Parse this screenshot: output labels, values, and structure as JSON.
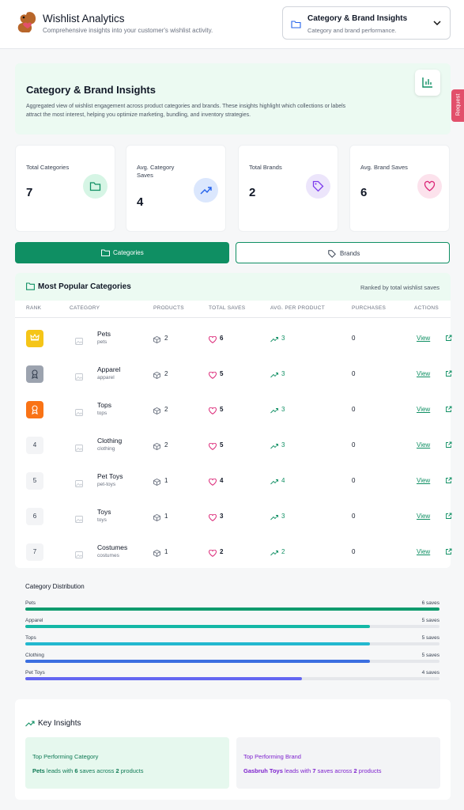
{
  "header": {
    "title": "Wishlist Analytics",
    "subtitle": "Comprehensive insights into your customer's wishlist activity."
  },
  "selector": {
    "title": "Category & Brand Insights",
    "subtitle": "Category and brand performance."
  },
  "request_tab": "Request",
  "hero": {
    "title": "Category & Brand Insights",
    "description": "Aggregated view of wishlist engagement across product categories and brands. These insights highlight which collections or labels attract the most interest, helping you optimize marketing, bundling, and inventory strategies."
  },
  "stats": [
    {
      "label": "Total Categories",
      "value": "7",
      "icon": "folder-icon",
      "color": "#0f8f63"
    },
    {
      "label": "Avg. Category Saves",
      "value": "4",
      "icon": "trending-up-icon",
      "color": "#2563eb"
    },
    {
      "label": "Total Brands",
      "value": "2",
      "icon": "tag-icon",
      "color": "#7c3aed"
    },
    {
      "label": "Avg. Brand Saves",
      "value": "6",
      "icon": "heart-icon",
      "color": "#db2777"
    }
  ],
  "tabs": {
    "categories": "Categories",
    "brands": "Brands"
  },
  "table": {
    "title": "Most Popular Categories",
    "ranked_note": "Ranked by total wishlist saves",
    "columns": [
      "RANK",
      "CATEGORY",
      "PRODUCTS",
      "TOTAL SAVES",
      "AVG. PER PRODUCT",
      "PURCHASES",
      "ACTIONS"
    ],
    "view_label": "View",
    "rows": [
      {
        "rank": "1",
        "rank_icon": "crown-icon",
        "name": "Pets",
        "slug": "pets",
        "products": "2",
        "saves": "6",
        "avg": "3",
        "purchases": "0"
      },
      {
        "rank": "2",
        "rank_icon": "medal-icon",
        "name": "Apparel",
        "slug": "apparel",
        "products": "2",
        "saves": "5",
        "avg": "3",
        "purchases": "0"
      },
      {
        "rank": "3",
        "rank_icon": "award-icon",
        "name": "Tops",
        "slug": "tops",
        "products": "2",
        "saves": "5",
        "avg": "3",
        "purchases": "0"
      },
      {
        "rank": "4",
        "name": "Clothing",
        "slug": "clothing",
        "products": "2",
        "saves": "5",
        "avg": "3",
        "purchases": "0"
      },
      {
        "rank": "5",
        "name": "Pet Toys",
        "slug": "pet-toys",
        "products": "1",
        "saves": "4",
        "avg": "4",
        "purchases": "0"
      },
      {
        "rank": "6",
        "name": "Toys",
        "slug": "toys",
        "products": "1",
        "saves": "3",
        "avg": "3",
        "purchases": "0"
      },
      {
        "rank": "7",
        "name": "Costumes",
        "slug": "costumes",
        "products": "1",
        "saves": "2",
        "avg": "2",
        "purchases": "0"
      }
    ]
  },
  "distribution": {
    "title": "Category Distribution",
    "items": [
      {
        "name": "Pets",
        "label": "6 saves",
        "fraction": 1.0,
        "color": "#0f9b6e"
      },
      {
        "name": "Apparel",
        "label": "5 saves",
        "fraction": 0.833,
        "color": "#14b8a6"
      },
      {
        "name": "Tops",
        "label": "5 saves",
        "fraction": 0.833,
        "color": "#22b8cf"
      },
      {
        "name": "Clothing",
        "label": "5 saves",
        "fraction": 0.833,
        "color": "#3b6fe0"
      },
      {
        "name": "Pet Toys",
        "label": "4 saves",
        "fraction": 0.667,
        "color": "#6366f1"
      }
    ]
  },
  "insights": {
    "title": "Key Insights",
    "category_card": {
      "title": "Top Performing Category",
      "name": "Pets",
      "t1": " leads with ",
      "saves": "6",
      "t2": " saves across ",
      "products": "2",
      "t3": " products"
    },
    "brand_card": {
      "title": "Top Performing Brand",
      "name": "Gasbruh Toys",
      "t1": " leads with ",
      "saves": "7",
      "t2": " saves across ",
      "products": "2",
      "t3": " products"
    }
  }
}
